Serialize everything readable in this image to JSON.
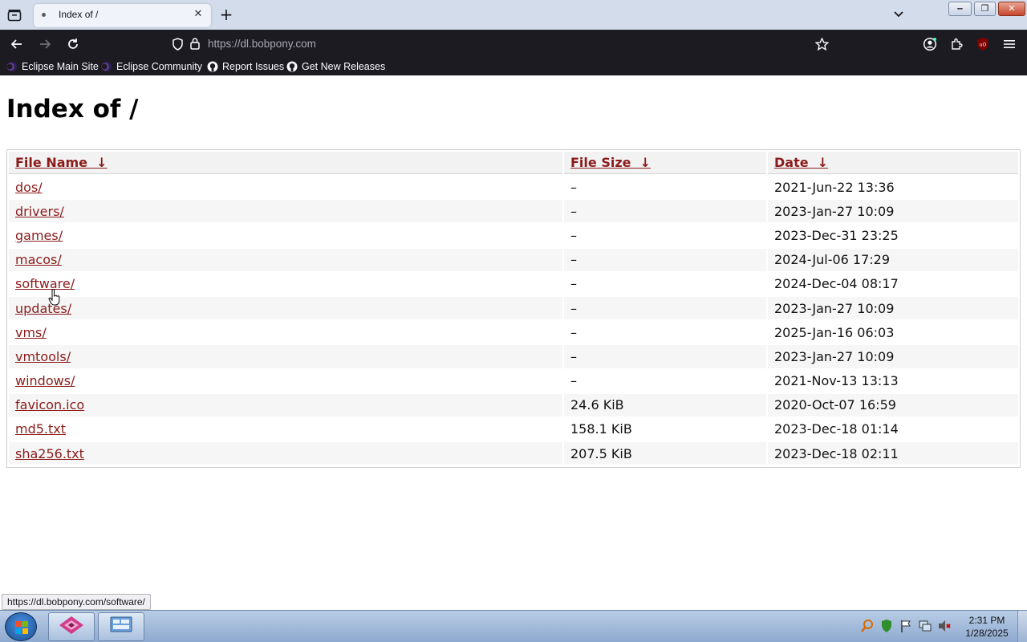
{
  "browser": {
    "tab_title": "Index of /",
    "url": "https://dl.bobpony.com",
    "bookmarks": [
      {
        "label": "Eclipse Main Site",
        "icon": "eclipse-icon"
      },
      {
        "label": "Eclipse Community",
        "icon": "eclipse-icon"
      },
      {
        "label": "Report Issues",
        "icon": "github-icon"
      },
      {
        "label": "Get New Releases",
        "icon": "github-icon"
      }
    ],
    "status_url": "https://dl.bobpony.com/software/"
  },
  "page": {
    "title": "Index of /",
    "columns": [
      {
        "label": "File Name",
        "sort_arrow": "↓"
      },
      {
        "label": "File Size",
        "sort_arrow": "↓"
      },
      {
        "label": "Date",
        "sort_arrow": "↓"
      }
    ],
    "rows": [
      {
        "name": "dos/",
        "size": "–",
        "date": "2021-Jun-22 13:36"
      },
      {
        "name": "drivers/",
        "size": "–",
        "date": "2023-Jan-27 10:09"
      },
      {
        "name": "games/",
        "size": "–",
        "date": "2023-Dec-31 23:25"
      },
      {
        "name": "macos/",
        "size": "–",
        "date": "2024-Jul-06 17:29"
      },
      {
        "name": "software/",
        "size": "–",
        "date": "2024-Dec-04 08:17"
      },
      {
        "name": "updates/",
        "size": "–",
        "date": "2023-Jan-27 10:09"
      },
      {
        "name": "vms/",
        "size": "–",
        "date": "2025-Jan-16 06:03"
      },
      {
        "name": "vmtools/",
        "size": "–",
        "date": "2023-Jan-27 10:09"
      },
      {
        "name": "windows/",
        "size": "–",
        "date": "2021-Nov-13 13:13"
      },
      {
        "name": "favicon.ico",
        "size": "24.6 KiB",
        "date": "2020-Oct-07 16:59"
      },
      {
        "name": "md5.txt",
        "size": "158.1 KiB",
        "date": "2023-Dec-18 01:14"
      },
      {
        "name": "sha256.txt",
        "size": "207.5 KiB",
        "date": "2023-Dec-18 02:11"
      }
    ]
  },
  "taskbar": {
    "time": "2:31 PM",
    "date": "1/28/2025"
  },
  "colors": {
    "link": "#8b1b1b",
    "toolbar_bg": "#1c1b22",
    "titlebar_bg": "#d3dcea"
  }
}
